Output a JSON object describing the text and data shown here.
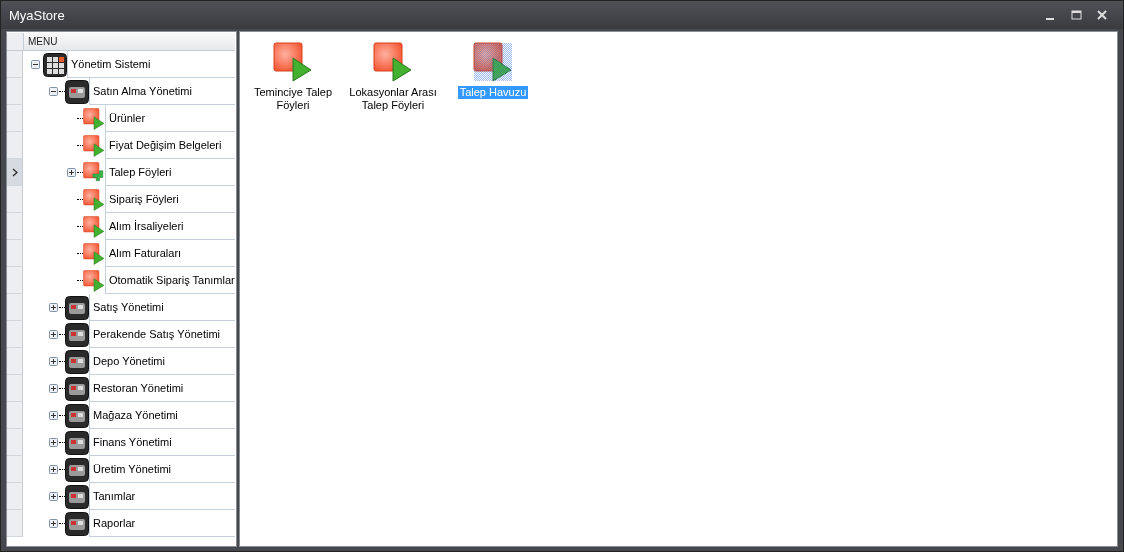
{
  "window": {
    "title": "MyaStore"
  },
  "menu": {
    "header": "MENU",
    "items": [
      {
        "label": "Yönetim Sistemi",
        "kind": "root",
        "expanded": true,
        "selected": false,
        "children": [
          {
            "label": "Satın Alma Yönetimi",
            "kind": "group",
            "expanded": true,
            "selected": false,
            "children": [
              {
                "label": "Ürünler",
                "kind": "leaf",
                "selected": false
              },
              {
                "label": "Fiyat Değişim Belgeleri",
                "kind": "leaf",
                "selected": false
              },
              {
                "label": "Talep Föyleri",
                "kind": "folder",
                "expanded": false,
                "selected": true
              },
              {
                "label": "Sipariş Föyleri",
                "kind": "leaf",
                "selected": false
              },
              {
                "label": "Alım İrsaliyeleri",
                "kind": "leaf",
                "selected": false
              },
              {
                "label": "Alım Faturaları",
                "kind": "leaf",
                "selected": false
              },
              {
                "label": "Otomatik Sipariş Tanımlar",
                "kind": "leaf",
                "selected": false
              }
            ]
          },
          {
            "label": "Satış Yönetimi",
            "kind": "group",
            "expanded": false,
            "selected": false
          },
          {
            "label": "Perakende Satış Yönetimi",
            "kind": "group",
            "expanded": false,
            "selected": false
          },
          {
            "label": "Depo Yönetimi",
            "kind": "group",
            "expanded": false,
            "selected": false
          },
          {
            "label": "Restoran Yönetimi",
            "kind": "group",
            "expanded": false,
            "selected": false
          },
          {
            "label": "Mağaza Yönetimi",
            "kind": "group",
            "expanded": false,
            "selected": false
          },
          {
            "label": "Finans Yönetimi",
            "kind": "group",
            "expanded": false,
            "selected": false
          },
          {
            "label": "Üretim Yönetimi",
            "kind": "group",
            "expanded": false,
            "selected": false
          },
          {
            "label": "Tanımlar",
            "kind": "group",
            "expanded": false,
            "selected": false
          },
          {
            "label": "Raporlar",
            "kind": "group",
            "expanded": false,
            "selected": false
          }
        ]
      }
    ]
  },
  "tiles": [
    {
      "label": "Teminciye Talep Föyleri",
      "selected": false
    },
    {
      "label": "Lokasyonlar Arası Talep Föyleri",
      "selected": false
    },
    {
      "label": "Talep Havuzu",
      "selected": true
    }
  ]
}
